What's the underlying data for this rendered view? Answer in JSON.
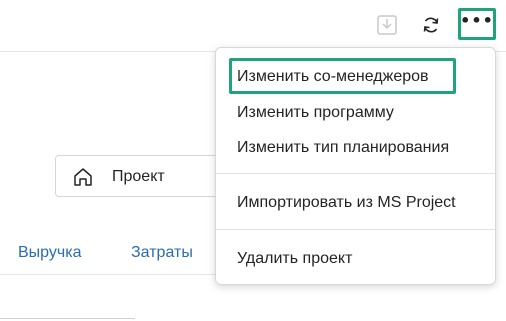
{
  "toolbar": {
    "import_icon": "import-arrow-icon",
    "sync_icon": "sync-icon",
    "more_label": "•••"
  },
  "project_selector": {
    "icon": "home-icon",
    "label": "Проект"
  },
  "tabs": [
    {
      "label": "Выручка"
    },
    {
      "label": "Затраты"
    }
  ],
  "menu": {
    "items": [
      {
        "label": "Изменить со-менеджеров"
      },
      {
        "label": "Изменить программу"
      },
      {
        "label": "Изменить тип планирования"
      },
      {
        "label": "Импортировать из MS Project"
      },
      {
        "label": "Удалить проект"
      }
    ]
  },
  "colors": {
    "highlight": "#1fa37c",
    "tab_link": "#2b6cb0"
  }
}
